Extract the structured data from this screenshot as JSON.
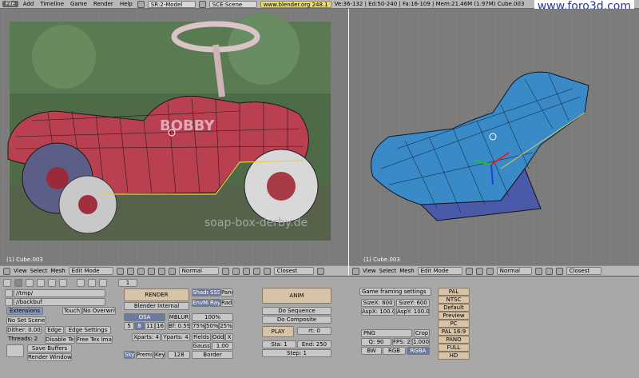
{
  "topbar": {
    "menus": [
      "File",
      "Add",
      "Timeline",
      "Game",
      "Render",
      "Help"
    ],
    "screen_field": "SR:2-Model",
    "scene_field": "SCE:Scene",
    "url": "www.blender.org 248.1",
    "stats": "Ve:36-132 | Ed:50-240 | Fa:16-109 | Mem:21.46M (1.97M) Cube.003"
  },
  "watermark": "www.foro3d.com",
  "left_viewport": {
    "label": "(1) Cube.003",
    "photo_watermark": "soap-box-derby.de"
  },
  "right_viewport": {
    "label": "(1) Cube.003"
  },
  "viewport_header": {
    "view": "View",
    "select": "Select",
    "mesh": "Mesh",
    "mode": "Edit Mode",
    "shading": "Normal",
    "snap": "Closest"
  },
  "buttons_header": {
    "frame": "1"
  },
  "output": {
    "path1": "//tmp/",
    "path2": "//backbuf",
    "extensions": "Extensions",
    "touch": "Touch",
    "no_overwrite": "No Overwrite",
    "no_set_scene": "No Set Scene",
    "dither": "Dither: 0.000",
    "edge": "Edge",
    "edge_settings": "Edge Settings",
    "threads": "Threads: 2",
    "disable_tex": "Disable Tex",
    "free_tex_image": "Free Tex Image",
    "save_buffers": "Save Buffers",
    "render_window": "Render Window"
  },
  "render": {
    "render_btn": "RENDER",
    "engine": "Blender Internal",
    "shadow": "Shado",
    "sss": "SSS",
    "pano": "Pano",
    "envmap": "EnvMa",
    "ray": "Ray",
    "radio": "Radi",
    "osa": "OSA",
    "mblur": "MBLUR",
    "percent100": "100%",
    "osa_values": [
      "5",
      "8",
      "11",
      "16"
    ],
    "bf": "Bf: 0.59",
    "percents": [
      "75%",
      "50%",
      "25%"
    ],
    "xparts": "Xparts: 4",
    "yparts": "Yparts: 4",
    "fields": "Fields",
    "odd": "Odd",
    "x": "X",
    "gauss": "Gauss",
    "gauss_val": "1.00",
    "sky": "Sky",
    "premul": "Premul",
    "key": "Key",
    "bits": "128",
    "border": "Border"
  },
  "anim": {
    "anim_btn": "ANIM",
    "do_sequence": "Do Sequence",
    "do_composite": "Do Composite",
    "play": "PLAY",
    "rt": "rt: 0",
    "sta": "Sta: 1",
    "end": "End: 250",
    "step": "Step: 1"
  },
  "format": {
    "game_framing": "Game framing settings",
    "sizex": "SizeX: 800",
    "sizey": "SizeY: 600",
    "aspx": "AspX: 100.00",
    "aspy": "AspY: 100.00",
    "format_name": "PNG",
    "crop": "Crop",
    "quality": "Q: 90",
    "fps": "FPS: 25",
    "fps_base": "1.000",
    "bw": "BW",
    "rgb": "RGB",
    "rgba": "RGBA"
  },
  "presets": [
    "PAL",
    "NTSC",
    "Default",
    "Preview",
    "PC",
    "PAL 16:9",
    "PANO",
    "FULL",
    "HD"
  ],
  "colors": {
    "header": "#b8b8b8",
    "viewport": "#7d7d7d",
    "panel": "#a8a8a8",
    "tan": "#d7c3a7",
    "mesh_red": "#b84050",
    "mesh_blue": "#3a8ac8"
  }
}
